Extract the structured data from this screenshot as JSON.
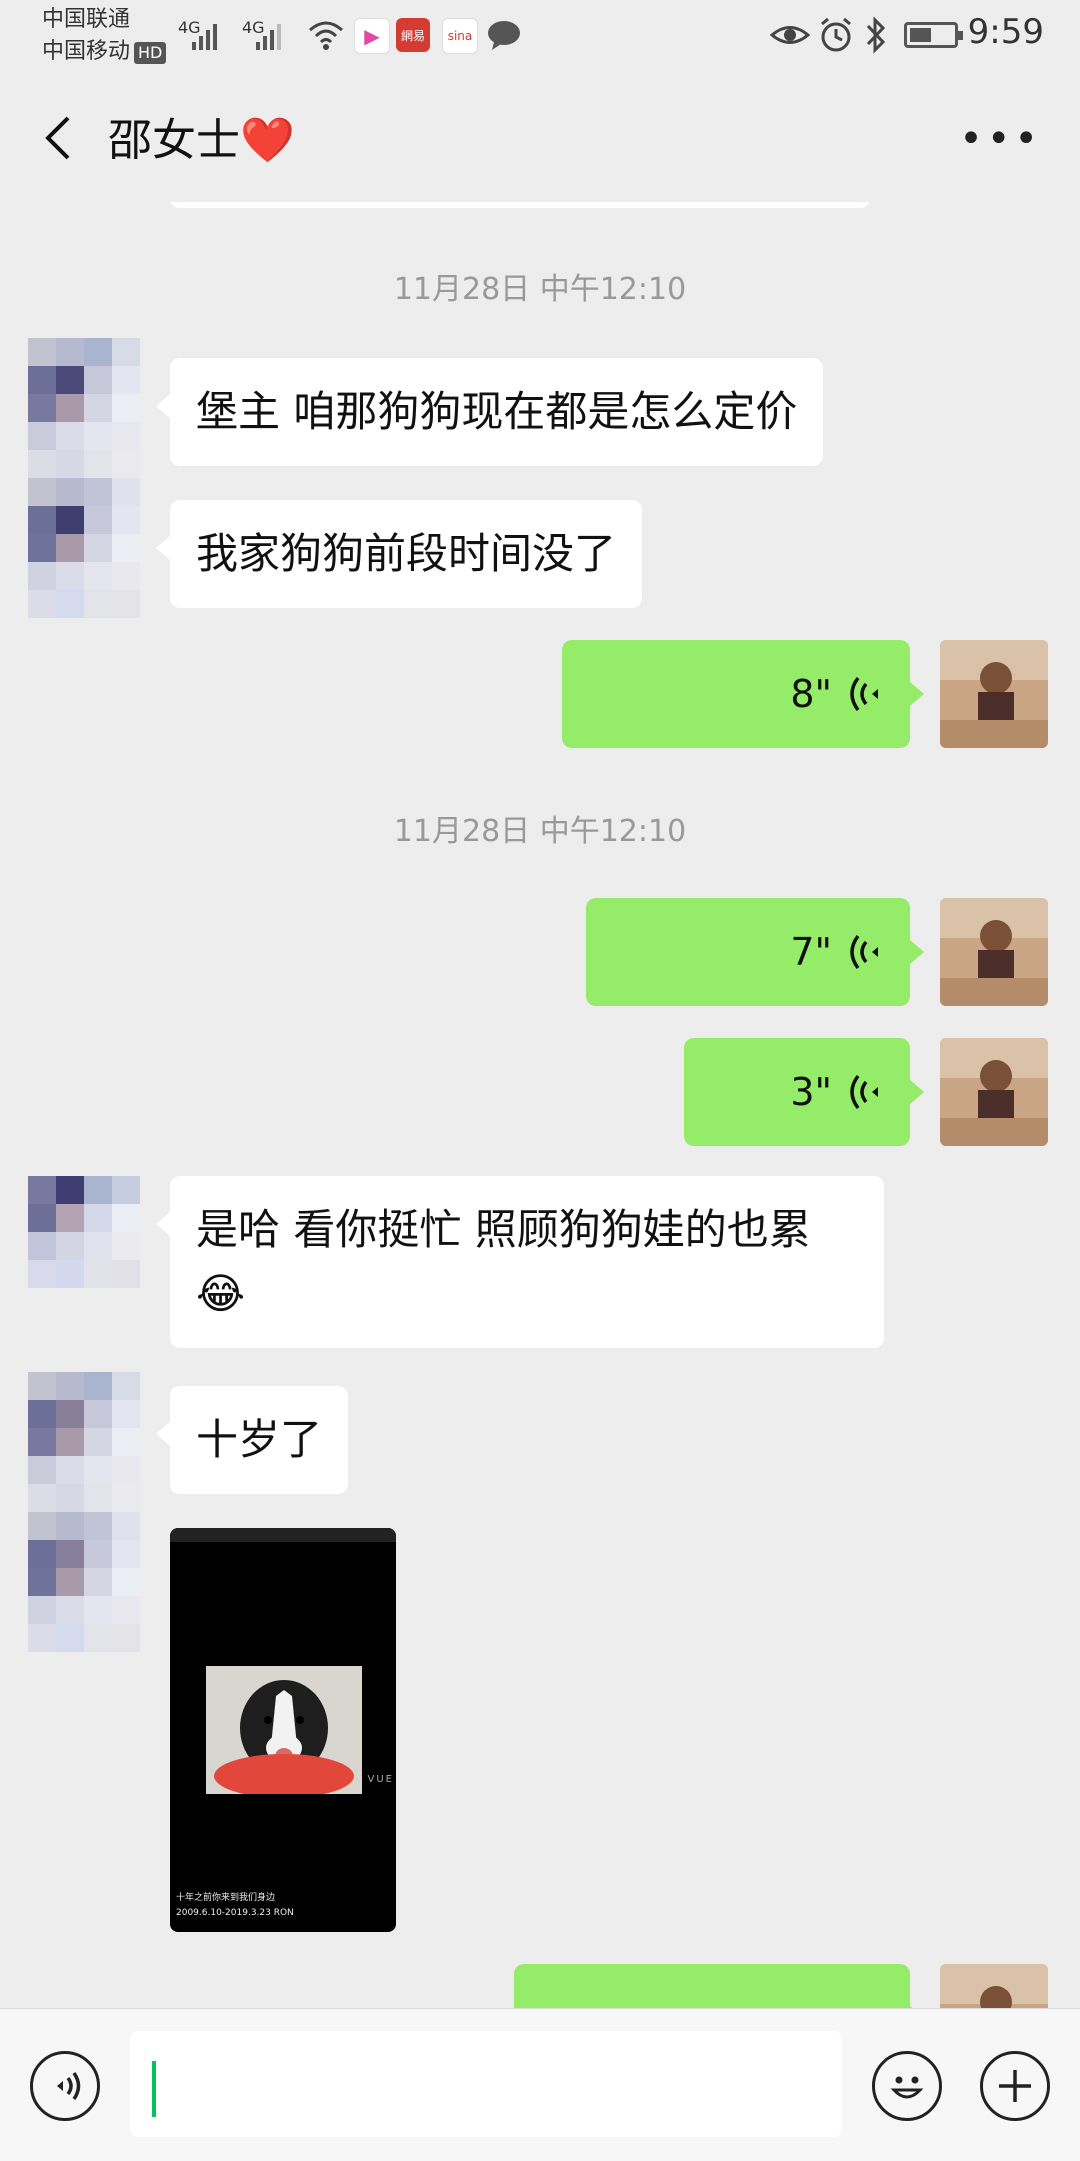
{
  "status_bar": {
    "carrier_1": "中国联通",
    "carrier_2": "中国移动",
    "hd_badge": "HD",
    "network_1": "4G",
    "network_2": "4G",
    "time": "9:59",
    "battery_level": 0.5
  },
  "header": {
    "title": "邵女士❤️"
  },
  "messages": {
    "timestamp_1": "11月28日 中午12:10",
    "m1": "堡主 咱那狗狗现在都是怎么定价",
    "m2": "我家狗狗前段时间没了",
    "v1_duration": "8\"",
    "timestamp_2": "11月28日 中午12:10",
    "v2_duration": "7\"",
    "v3_duration": "3\"",
    "m3": "是哈 看你挺忙 照顾狗狗娃的也累",
    "m3_emoji": "😂",
    "m4": "十岁了",
    "image_caption_1": "十年之前你来到我们身边",
    "image_caption_2": "2009.6.10-2019.3.23  RON",
    "image_side_text": "VUE"
  },
  "colors": {
    "background": "#ededed",
    "green_bubble": "#95ec69",
    "white_bubble": "#ffffff",
    "caret": "#07c160"
  }
}
